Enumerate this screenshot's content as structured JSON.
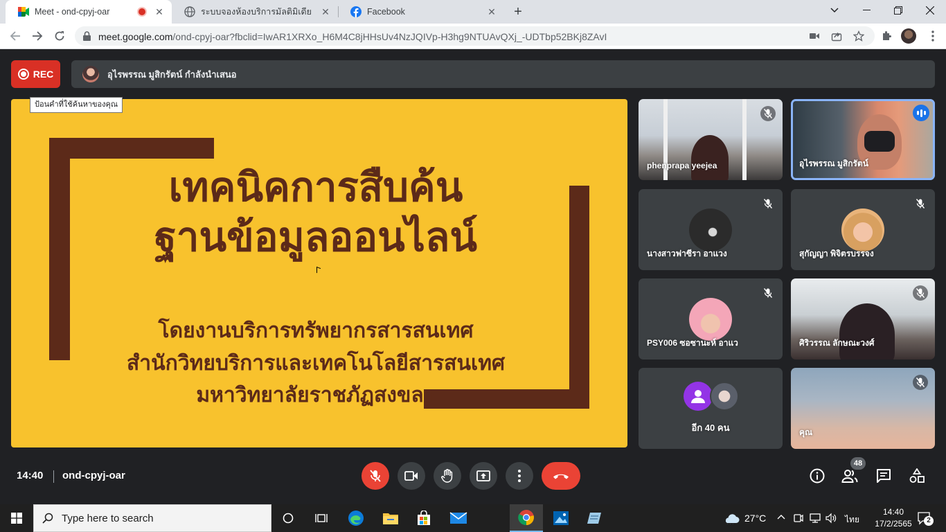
{
  "browser": {
    "tabs": [
      {
        "title": "Meet - ond-cpyj-oar",
        "icon": "google-meet-icon",
        "recording": true
      },
      {
        "title": "ระบบจองห้องบริการมัลติมิเดีย",
        "icon": "globe-icon"
      },
      {
        "title": "Facebook",
        "icon": "facebook-icon"
      }
    ],
    "url_host": "meet.google.com",
    "url_path": "/ond-cpyj-oar?fbclid=IwAR1XRXo_H6M4C8jHHsUv4NzJQIVp-H3hg9NTUAvQXj_-UDTbp52BKj8ZAvI"
  },
  "meet": {
    "rec_label": "REC",
    "presenting_text": "อุไรพรรณ มูสิกรัตน์ กำลังนำเสนอ",
    "tooltip": "ป้อนคำที่ใช้ค้นหาของคุณ",
    "slide": {
      "title_line1": "เทคนิคการสืบค้น",
      "title_line2": "ฐานข้อมูลออนไลน์",
      "sub_line1": "โดยงานบริการทรัพยากรสารสนเทศ",
      "sub_line2": "สำนักวิทยบริการและเทคโนโลยีสารสนเทศ",
      "sub_line3": "มหาวิทยาลัยราชภัฏสงขลา",
      "bg_color": "#f8c22d",
      "frame_color": "#5c2a19"
    },
    "participants": [
      {
        "name": "phenprapa yeejea",
        "muted": true
      },
      {
        "name": "อุไรพรรณ มูสิกรัตน์",
        "speaking": true
      },
      {
        "name": "นางสาวฟาซีรา อาแวง",
        "muted": true
      },
      {
        "name": "สุกัญญา พิจิตรบรรจง",
        "muted": true
      },
      {
        "name": "PSY006 ซอซานะห์ อาแว",
        "muted": true
      },
      {
        "name": "ศิริวรรณ ลักษณะวงศ์",
        "muted": true
      },
      {
        "name": "อีก 40 คน"
      },
      {
        "name": "คุณ",
        "muted": true
      }
    ],
    "time": "14:40",
    "meeting_code": "ond-cpyj-oar",
    "people_count": "48"
  },
  "taskbar": {
    "search_placeholder": "Type here to search",
    "weather": "27°C",
    "lang": "ไทย",
    "time": "14:40",
    "date": "17/2/2565",
    "notif_count": "2"
  }
}
